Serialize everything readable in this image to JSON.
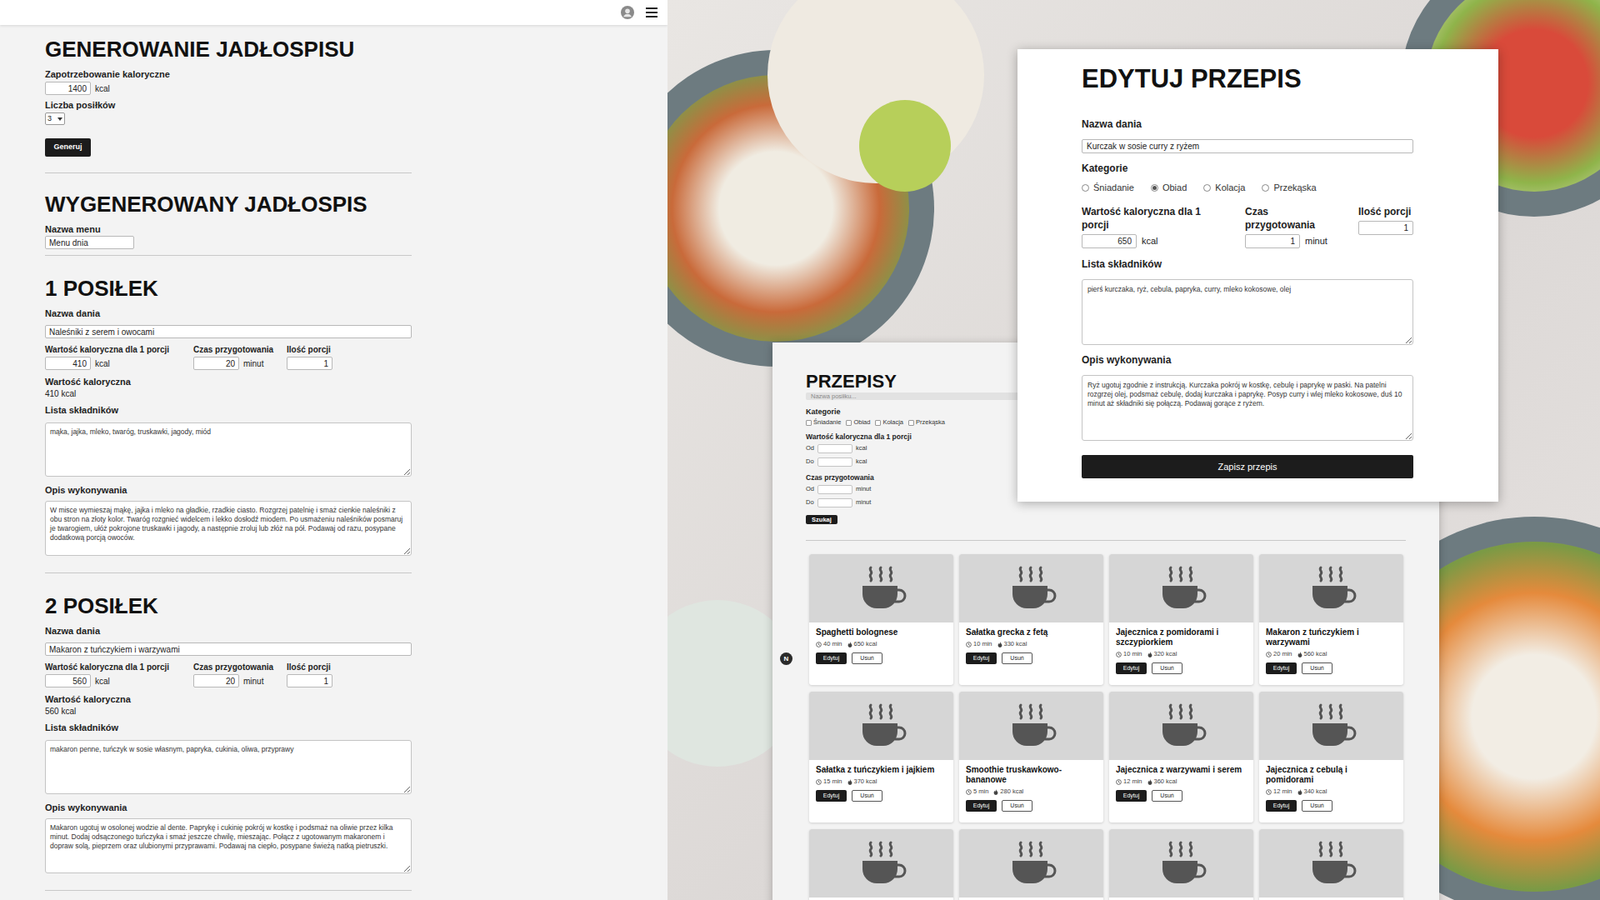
{
  "generator": {
    "title": "GENEROWANIE JADŁOSPISU",
    "calories_label": "Zapotrzebowanie kaloryczne",
    "calories_value": "1400",
    "calories_unit": "kcal",
    "meals_label": "Liczba posiłków",
    "meals_value": "3",
    "button": "Generuj"
  },
  "generated": {
    "title": "WYGENEROWANY JADŁOSPIS",
    "menu_label": "Nazwa menu",
    "menu_value": "Menu dnia"
  },
  "meals": [
    {
      "heading": "1 POSIŁEK",
      "dish_label": "Nazwa dania",
      "dish": "Naleśniki z serem i owocami",
      "kcal_label": "Wartość kaloryczna dla 1 porcji",
      "kcal": "410",
      "kcal_unit": "kcal",
      "time_label": "Czas przygotowania",
      "time": "20",
      "time_unit": "minut",
      "portions_label": "Ilość porcji",
      "portions": "1",
      "total_label": "Wartość kaloryczna",
      "total": "410 kcal",
      "ingredients_label": "Lista składników",
      "ingredients": "mąka, jajka, mleko, twaróg, truskawki, jagody, miód",
      "description_label": "Opis wykonywania",
      "description": "W misce wymieszaj mąkę, jajka i mleko na gładkie, rzadkie ciasto. Rozgrzej patelnię i smaż cienkie naleśniki z obu stron na złoty kolor. Twaróg rozgnieć widelcem i lekko dosłodź miodem. Po usmażeniu naleśników posmaruj je twarogiem, ułóż pokrojone truskawki i jagody, a następnie zroluj lub złóż na pół. Podawaj od razu, posypane dodatkową porcją owoców."
    },
    {
      "heading": "2 POSIŁEK",
      "dish_label": "Nazwa dania",
      "dish": "Makaron z tuńczykiem i warzywami",
      "kcal_label": "Wartość kaloryczna dla 1 porcji",
      "kcal": "560",
      "kcal_unit": "kcal",
      "time_label": "Czas przygotowania",
      "time": "20",
      "time_unit": "minut",
      "portions_label": "Ilość porcji",
      "portions": "1",
      "total_label": "Wartość kaloryczna",
      "total": "560 kcal",
      "ingredients_label": "Lista składników",
      "ingredients": "makaron penne, tuńczyk w sosie własnym, papryka, cukinia, oliwa, przyprawy",
      "description_label": "Opis wykonywania",
      "description": "Makaron ugotuj w osolonej wodzie al dente. Paprykę i cukinię pokrój w kostkę i podsmaż na oliwie przez kilka minut. Dodaj odsączonego tuńczyka i smaż jeszcze chwilę, mieszając. Połącz z ugotowanym makaronem i dopraw solą, pieprzem oraz ulubionymi przyprawami. Podawaj na ciepło, posypane świeżą natką pietruszki."
    }
  ],
  "recipes_window": {
    "title": "PRZEPISY",
    "search_placeholder": "Nazwa posiłku...",
    "categories_label": "Kategorie",
    "categories": [
      {
        "label": "Śniadanie",
        "checked": false
      },
      {
        "label": "Obiad",
        "checked": false
      },
      {
        "label": "Kolacja",
        "checked": false
      },
      {
        "label": "Przekąska",
        "checked": false
      }
    ],
    "calories_label": "Wartość kaloryczna dla 1 porcji",
    "time_label": "Czas przygotowania",
    "from_label": "Od",
    "to_label": "Do",
    "kcal_unit": "kcal",
    "minutes_unit": "minut",
    "search_button": "Szukaj",
    "edit_button": "Edytuj",
    "delete_button": "Usuń",
    "cards": [
      {
        "kind": "full",
        "title": "Spaghetti bolognese",
        "time": "40 min",
        "kcal": "650 kcal"
      },
      {
        "kind": "full",
        "title": "Sałatka grecka z fetą",
        "time": "10 min",
        "kcal": "330 kcal"
      },
      {
        "kind": "full",
        "title": "Jajecznica z pomidorami i szczypiorkiem",
        "time": "10 min",
        "kcal": "320 kcal"
      },
      {
        "kind": "full",
        "title": "Makaron z tuńczykiem i warzywami",
        "time": "20 min",
        "kcal": "560 kcal"
      },
      {
        "kind": "full",
        "title": "Sałatka z tuńczykiem i jajkiem",
        "time": "15 min",
        "kcal": "370 kcal"
      },
      {
        "kind": "full",
        "title": "Smoothie truskawkowo-bananowe",
        "time": "5 min",
        "kcal": "280 kcal"
      },
      {
        "kind": "full",
        "title": "Jajecznica z warzywami i serem",
        "time": "12 min",
        "kcal": "360 kcal"
      },
      {
        "kind": "full",
        "title": "Jajecznica z cebulą i pomidorami",
        "time": "12 min",
        "kcal": "340 kcal"
      },
      {
        "kind": "cut"
      },
      {
        "kind": "cut"
      },
      {
        "kind": "cut"
      },
      {
        "kind": "cut"
      }
    ]
  },
  "dev_badge": "N",
  "edit_window": {
    "title": "EDYTUJ PRZEPIS",
    "name_label": "Nazwa dania",
    "name": "Kurczak w sosie curry z ryżem",
    "categories_label": "Kategorie",
    "categories": [
      {
        "label": "Śniadanie",
        "selected": false
      },
      {
        "label": "Obiad",
        "selected": true
      },
      {
        "label": "Kolacja",
        "selected": false
      },
      {
        "label": "Przekąska",
        "selected": false
      }
    ],
    "kcal_label": "Wartość kaloryczna dla 1 porcji",
    "kcal": "650",
    "kcal_unit": "kcal",
    "time_label": "Czas przygotowania",
    "time": "1",
    "time_unit": "minut",
    "portions_label": "Ilość porcji",
    "portions": "1",
    "ingredients_label": "Lista składników",
    "ingredients": "pierś kurczaka, ryż, cebula, papryka, curry, mleko kokosowe, olej",
    "description_label": "Opis wykonywania",
    "description": "Ryż ugotuj zgodnie z instrukcją. Kurczaka pokrój w kostkę, cebulę i paprykę w paski. Na patelni rozgrzej olej, podsmaż cebulę, dodaj kurczaka i paprykę. Posyp curry i wlej mleko kokosowe, duś 10 minut aż składniki się połączą. Podawaj gorące z ryżem.",
    "save_button": "Zapisz przepis"
  }
}
